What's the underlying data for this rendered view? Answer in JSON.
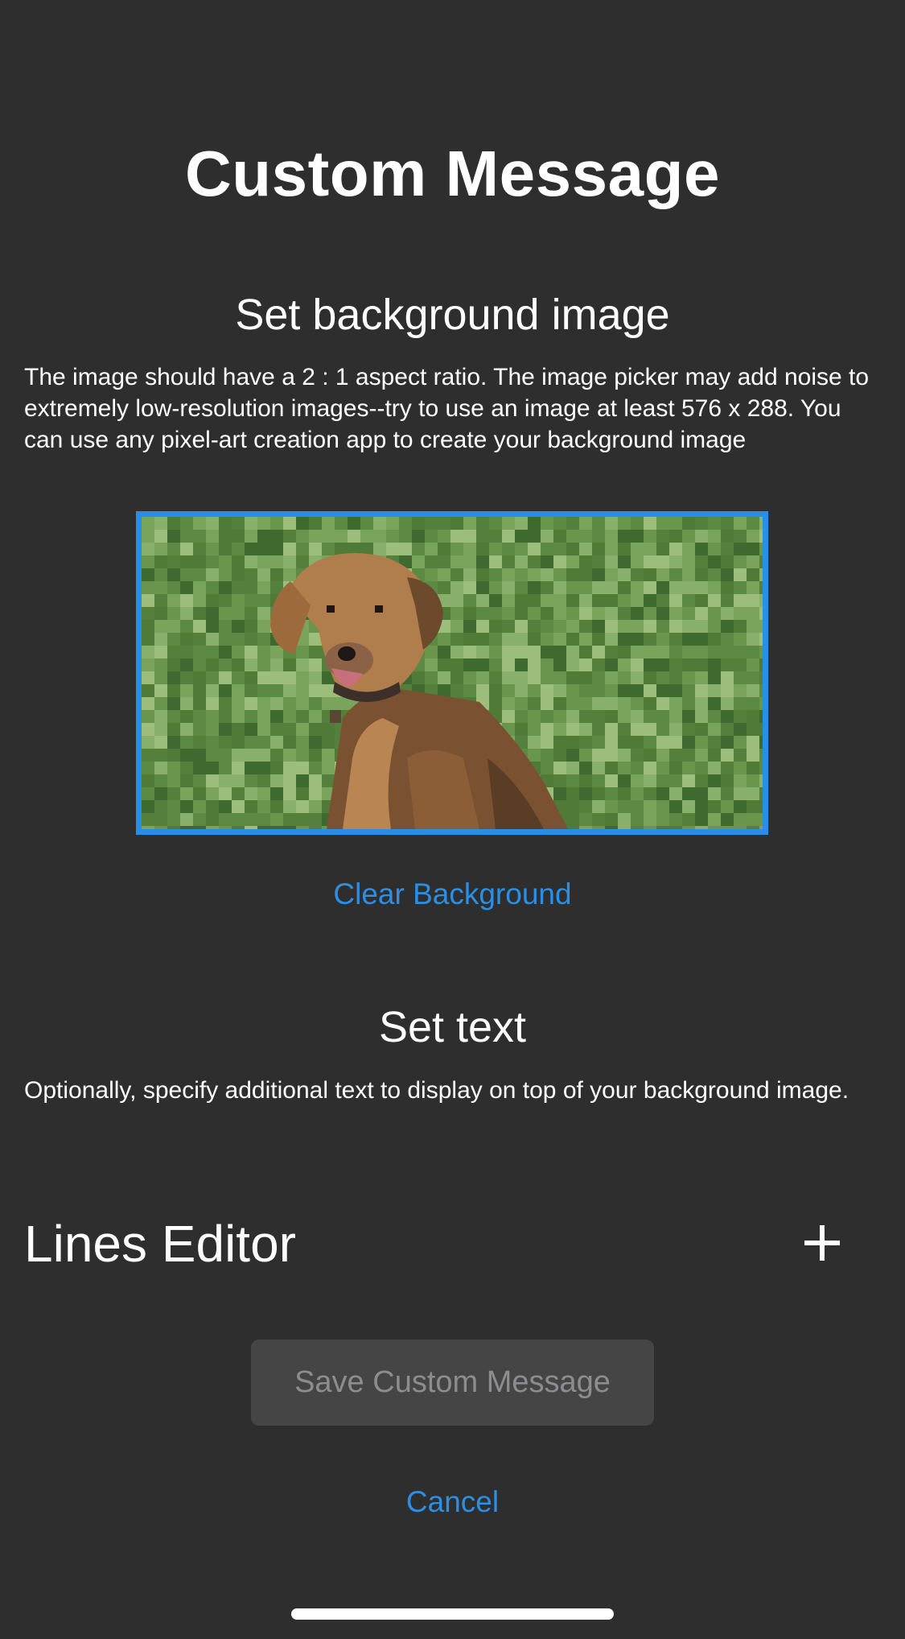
{
  "page": {
    "title": "Custom Message"
  },
  "background_section": {
    "heading": "Set background image",
    "description": "The image should have a 2 : 1 aspect ratio. The image picker may add noise to extremely low-resolution images--try to use an image at least 576 x 288. You can use any pixel-art creation app to create your background image",
    "image": {
      "subject": "pixelated-dog-on-grass",
      "border_color": "#2a8de6"
    },
    "clear_label": "Clear Background"
  },
  "text_section": {
    "heading": "Set text",
    "description": "Optionally, specify additional text to display on top of your background image."
  },
  "lines_editor": {
    "title": "Lines Editor",
    "add_icon": "plus-icon"
  },
  "actions": {
    "save_label": "Save Custom Message",
    "save_enabled": false,
    "cancel_label": "Cancel"
  },
  "colors": {
    "background": "#2e2e2f",
    "accent": "#2b8fe6",
    "disabled_button_bg": "#454546",
    "disabled_button_text": "#8d8d8f"
  }
}
